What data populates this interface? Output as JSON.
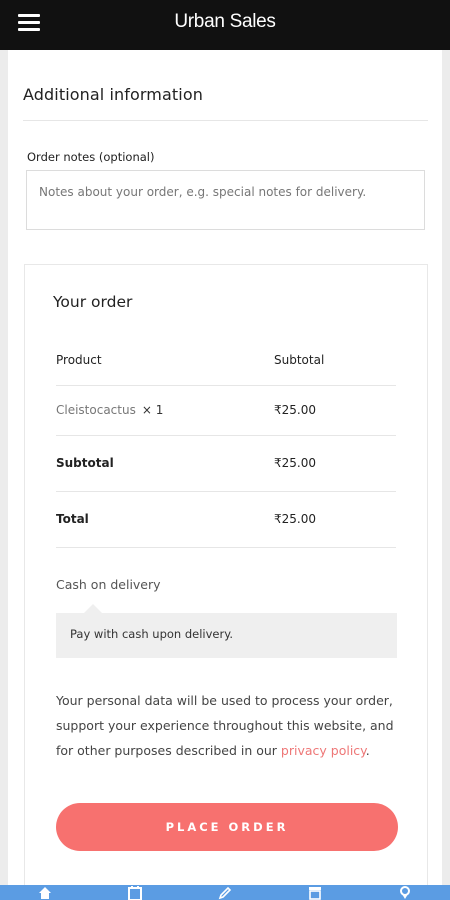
{
  "app_bar": {
    "title": "Urban Sales",
    "menu_icon": "hamburger-menu-icon"
  },
  "additional_info": {
    "title": "Additional information",
    "notes_label": "Order notes (optional)",
    "notes_placeholder": "Notes about your order, e.g. special notes for delivery."
  },
  "order": {
    "title": "Your order",
    "columns": [
      "Product",
      "Subtotal"
    ],
    "items": [
      {
        "name": "Cleistocactus",
        "qty": "× 1",
        "subtotal": "₹25.00"
      }
    ],
    "subtotal_label": "Subtotal",
    "subtotal_value": "₹25.00",
    "total_label": "Total",
    "total_value": "₹25.00"
  },
  "payment": {
    "method_label": "Cash on delivery",
    "description": "Pay with cash upon delivery."
  },
  "privacy": {
    "text": "Your personal data will be used to process your order, support your experience throughout this website, and for other purposes described in our ",
    "link_text": "privacy policy",
    "suffix": "."
  },
  "place_order_label": "PLACE ORDER",
  "bottom_nav": {
    "items": [
      "home-icon",
      "calendar-icon",
      "pencil-icon",
      "store-icon",
      "location-pin-icon"
    ]
  },
  "colors": {
    "app_bar": "#111111",
    "accent_button": "#f7716f",
    "link": "#ee7777",
    "bottom_nav": "#5b9ce3"
  }
}
